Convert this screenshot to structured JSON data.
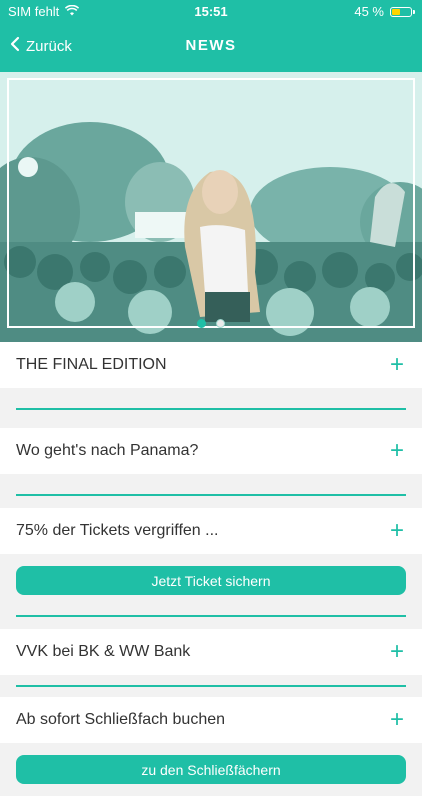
{
  "status": {
    "carrier": "SIM fehlt",
    "time": "15:51",
    "battery": "45 %",
    "battery_level": 0.45
  },
  "nav": {
    "back_label": "Zurück",
    "title": "NEWS"
  },
  "carousel": {
    "active_index": 0,
    "count": 2
  },
  "news": [
    {
      "label": "THE FINAL EDITION"
    },
    {
      "label": "Wo geht's nach Panama?"
    },
    {
      "label": "75% der Tickets vergriffen ...",
      "button": "Jetzt Ticket sichern"
    },
    {
      "label": "VVK bei BK & WW Bank"
    },
    {
      "label": "Ab sofort Schließfach buchen",
      "button": "zu den Schließfächern"
    }
  ],
  "icons": {
    "expand": "+"
  },
  "colors": {
    "accent": "#1fbfa6",
    "battery": "#ffd400"
  }
}
